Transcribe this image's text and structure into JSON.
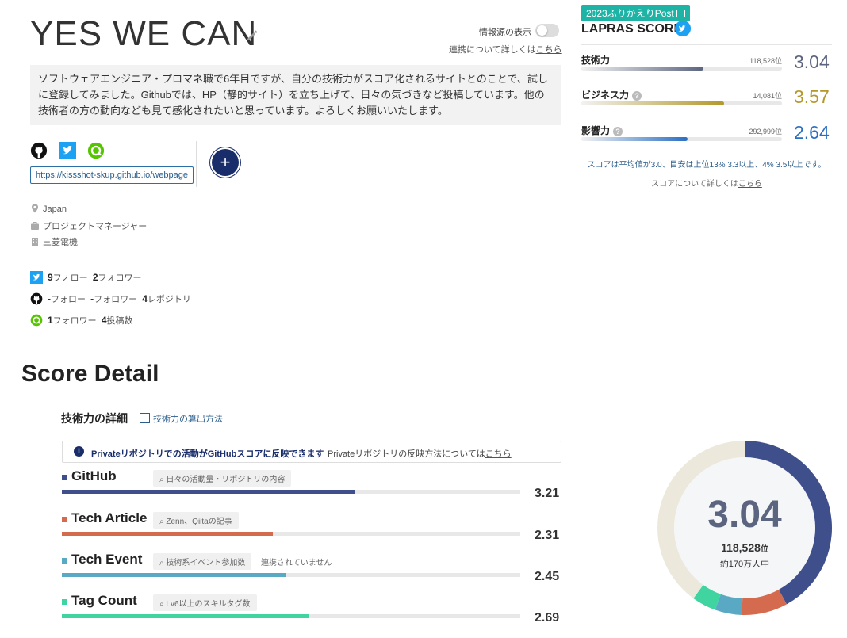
{
  "profile": {
    "name": "YES WE CAN",
    "source_toggle_label": "情報源の表示",
    "renkei_prefix": "連携について詳しくは",
    "renkei_link": "こちら",
    "bio": "ソフトウェアエンジニア・プロマネ職で6年目ですが、自分の技術力がスコア化されるサイトとのことで、試しに登録してみました。Githubでは、HP（静的サイト）を立ち上げて、日々の気づきなど投稿しています。他の技術者の方の動向なども見て感化されたいと思っています。よろしくお願いいたします。",
    "webpage_url": "https://kissshot-skup.github.io/webpage",
    "add_button_label": "+",
    "location": "Japan",
    "job": "プロジェクトマネージャー",
    "company": "三菱電機"
  },
  "stats": {
    "twitter": {
      "follow_num": "9",
      "follow_label": "フォロー",
      "follower_num": "2",
      "follower_label": "フォロワー"
    },
    "github": {
      "follow_num": "-",
      "follow_label": "フォロー",
      "follower_num": "-",
      "follower_label": "フォロワー",
      "repo_num": "4",
      "repo_label": "レポジトリ"
    },
    "qiita": {
      "follower_num": "1",
      "follower_label": "フォロワー",
      "post_num": "4",
      "post_label": "投稿数"
    }
  },
  "lapras": {
    "badge": "2023ふりかえりPost",
    "title": "LAPRAS SCORE",
    "scores": [
      {
        "label": "技術力",
        "rank": "118,528位",
        "score": "3.04",
        "fill_fraction": 0.61,
        "color": "#5c6580",
        "has_help": false
      },
      {
        "label": "ビジネス力",
        "rank": "14,081位",
        "score": "3.57",
        "fill_fraction": 0.71,
        "color": "#b3982a",
        "has_help": true
      },
      {
        "label": "影響力",
        "rank": "292,999位",
        "score": "2.64",
        "fill_fraction": 0.53,
        "color": "#2a6fc4",
        "has_help": true
      }
    ],
    "note": "スコアは平均値が3.0、目安は上位13% 3.3以上、4% 3.5以上です。",
    "detail_prefix": "スコアについて詳しくは",
    "detail_link": "こちら"
  },
  "score_detail": {
    "title": "Score Detail",
    "subtitle": "技術力の詳細",
    "calc_link": "技術力の算出方法",
    "private_notice": "Privateリポジトリでの活動がGitHubスコアに反映できます",
    "private_method_prefix": "Privateリポジトリの反映方法については",
    "private_method_link": "こちら",
    "categories": [
      {
        "name": "GitHub",
        "hint": "日々の活動量・リポジトリの内容",
        "score": "3.21",
        "fill_fraction": 0.64,
        "color": "#3f4f8c",
        "note": ""
      },
      {
        "name": "Tech Article",
        "hint": "Zenn、Qiitaの記事",
        "score": "2.31",
        "fill_fraction": 0.46,
        "color": "#d46a4e",
        "note": ""
      },
      {
        "name": "Tech Event",
        "hint": "技術系イベント参加数",
        "score": "2.45",
        "fill_fraction": 0.49,
        "color": "#5aa9c4",
        "note": "連携されていません"
      },
      {
        "name": "Tag Count",
        "hint": "Lv6以上のスキルタグ数",
        "score": "2.69",
        "fill_fraction": 0.54,
        "color": "#3fd4a0",
        "note": ""
      }
    ],
    "donut": {
      "score": "3.04",
      "rank_num": "118,528",
      "rank_unit": "位",
      "population": "約170万人中",
      "segments": [
        {
          "name": "GitHub",
          "fraction": 0.42,
          "color": "#3f4f8c"
        },
        {
          "name": "Tech Article",
          "fraction": 0.085,
          "color": "#d46a4e"
        },
        {
          "name": "Tech Event",
          "fraction": 0.05,
          "color": "#5aa9c4"
        },
        {
          "name": "Tag Count",
          "fraction": 0.045,
          "color": "#3fd4a0"
        },
        {
          "name": "remaining",
          "fraction": 0.4,
          "color": "#ece9dc"
        }
      ]
    }
  }
}
